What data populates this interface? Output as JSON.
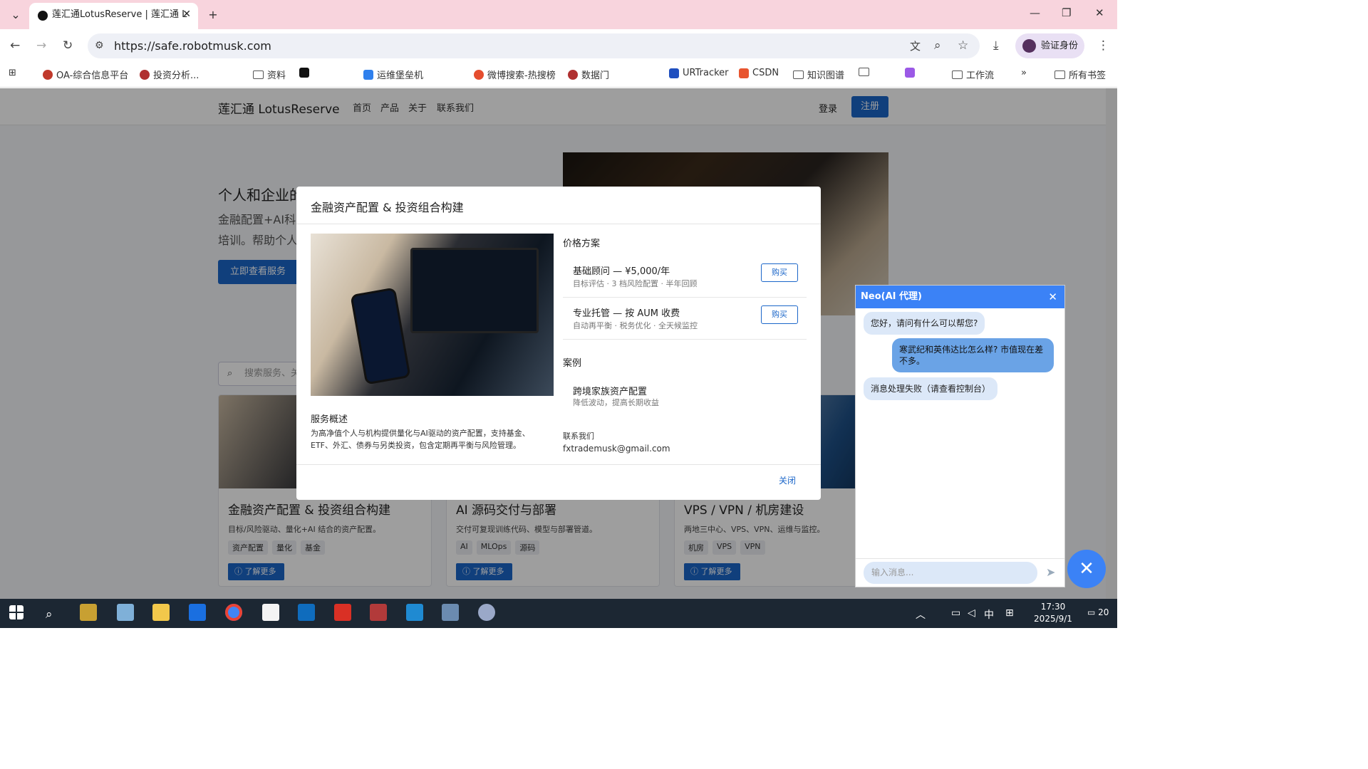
{
  "browser": {
    "tab_title": "莲汇通LotusReserve | 莲汇通 L",
    "url": "https://safe.robotmusk.com",
    "profile_label": "验证身份",
    "bookmarks": [
      "OA-综合信息平台",
      "投资分析...",
      "资料",
      "运维堡垒机",
      "微博搜索-热搜榜",
      "数据门",
      "URTracker",
      "CSDN",
      "知识图谱",
      "工作流",
      "所有书签"
    ]
  },
  "site": {
    "brand": "莲汇通 LotusReserve",
    "nav": [
      "首页",
      "产品",
      "关于",
      "联系我们"
    ],
    "login": "登录",
    "register": "注册",
    "hero_title": "个人和企业的",
    "hero_text": "金融配置+AI科 培训。帮助个人",
    "hero_button": "立即查看服务",
    "search_placeholder": "搜索服务、关",
    "cards": [
      {
        "title": "金融资产配置 & 投资组合构建",
        "desc": "目标/风险驱动、量化+AI 结合的资产配置。",
        "tags": [
          "资产配置",
          "量化",
          "基金"
        ],
        "more": "了解更多"
      },
      {
        "title": "AI 源码交付与部署",
        "desc": "交付可复现训练代码、模型与部署管道。",
        "tags": [
          "AI",
          "MLOps",
          "源码"
        ],
        "more": "了解更多"
      },
      {
        "title": "VPS / VPN / 机房建设",
        "desc": "两地三中心、VPS、VPN、运维与监控。",
        "tags": [
          "机房",
          "VPS",
          "VPN"
        ],
        "more": "了解更多"
      }
    ]
  },
  "modal": {
    "title": "金融资产配置 & 投资组合构建",
    "overview_heading": "服务概述",
    "overview_text": "为高净值个人与机构提供量化与AI驱动的资产配置，支持基金、ETF、外汇、债券与另类投资，包含定期再平衡与风险管理。",
    "pricing_heading": "价格方案",
    "plans": [
      {
        "name": "基础顾问 — ¥5,000/年",
        "detail": "目标评估 · 3 档风险配置 · 半年回顾",
        "buy": "购买"
      },
      {
        "name": "专业托管 — 按 AUM 收费",
        "detail": "自动再平衡 · 税务优化 · 全天候监控",
        "buy": "购买"
      }
    ],
    "cases_heading": "案例",
    "case_title": "跨境家族资产配置",
    "case_detail": "降低波动，提高长期收益",
    "contact_heading": "联系我们",
    "contact_email": "fxtrademusk@gmail.com",
    "close": "关闭"
  },
  "chat": {
    "title": "Neo(AI 代理)",
    "messages": [
      {
        "role": "bot",
        "text": "您好，请问有什么可以帮您?"
      },
      {
        "role": "user",
        "text": "寒武纪和英伟达比怎么样? 市值现在差不多。"
      },
      {
        "role": "bot",
        "text": "消息处理失败（请查看控制台）"
      }
    ],
    "input_placeholder": "输入消息..."
  },
  "taskbar": {
    "time": "17:30",
    "date": "2025/9/1",
    "ime": "中",
    "notifications": "20"
  }
}
